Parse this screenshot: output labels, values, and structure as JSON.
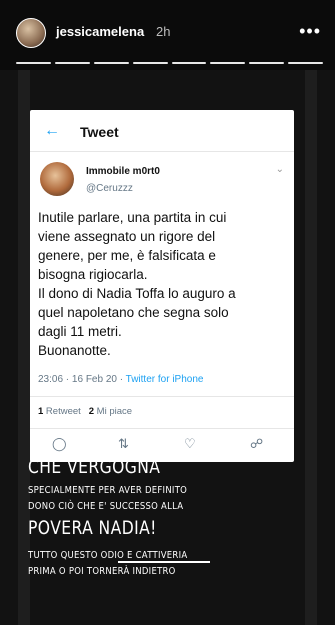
{
  "header": {
    "username": "jessicamelena",
    "time": "2h",
    "more_icon": "more-horizontal-icon",
    "progress_segments": 8
  },
  "tweet": {
    "screen_title": "Tweet",
    "back_icon": "arrow-left-icon",
    "author_name": "Immobile m0rt0",
    "author_handle": "@Ceruzzz",
    "text_lines": [
      "Inutile parlare, una partita in cui",
      "viene assegnato un rigore del",
      "genere, per me, è falsificata e",
      "bisogna rigiocarla.",
      "Il dono di Nadia Toffa lo auguro a",
      "quel napoletano che segna solo",
      "dagli 11 metri.",
      "Buonanotte."
    ],
    "timestamp": "23:06 · 16 Feb 20 · ",
    "source": "Twitter for iPhone",
    "retweet_count": "1",
    "retweet_label": " Retweet",
    "likes_count": "2",
    "likes_label": " Mi piace",
    "actions": [
      "comment-icon",
      "retweet-icon",
      "heart-icon",
      "share-icon"
    ]
  },
  "caption": {
    "line1": "CHE VERGOGNA",
    "line2": "SPECIALMENTE PER AVER DEFINITO",
    "line3": "DONO CIÒ CHE E' SUCCESSO ALLA",
    "line4": "POVERA NADIA!",
    "line5": "TUTTO QUESTO ODIO E CATTIVERIA",
    "line6": "PRIMA O POI TORNERÀ INDIETRO"
  }
}
